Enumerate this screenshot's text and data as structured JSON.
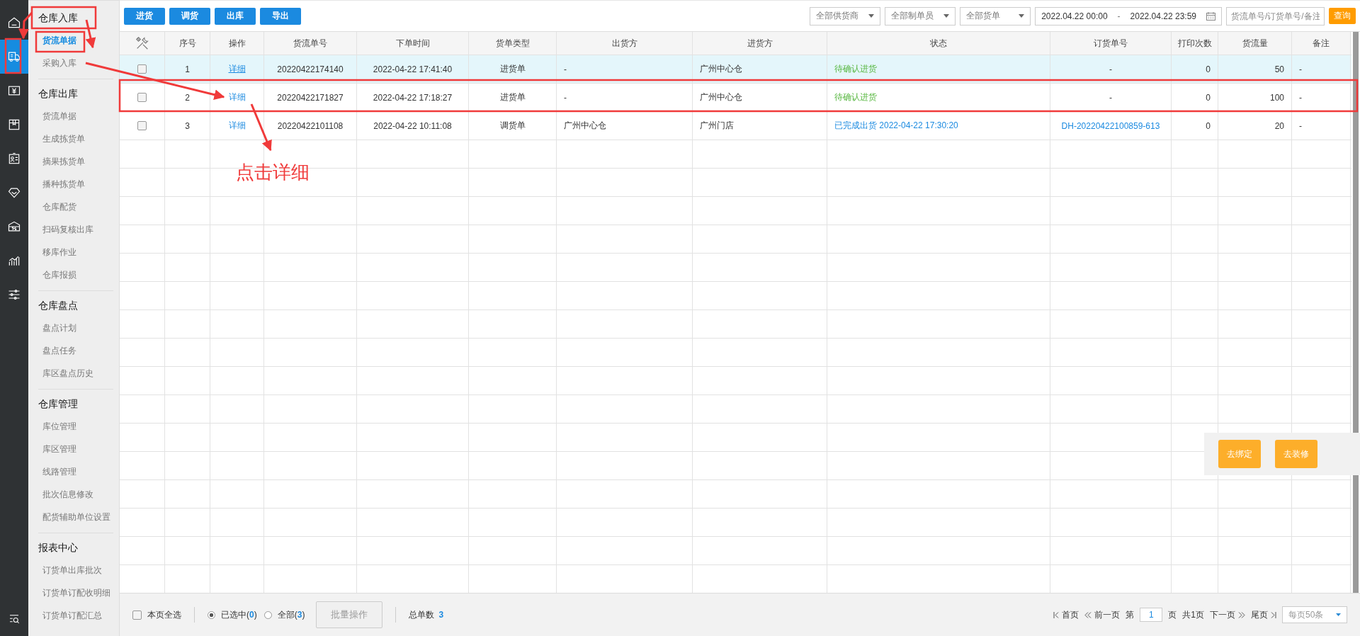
{
  "rail": {
    "items": [
      {
        "selected": false
      },
      {
        "selected": true
      },
      {
        "selected": false
      },
      {
        "selected": false
      },
      {
        "selected": false
      },
      {
        "selected": false
      },
      {
        "selected": false
      },
      {
        "selected": false
      },
      {
        "selected": false
      }
    ]
  },
  "sidebar": {
    "groups": [
      {
        "title": "仓库入库",
        "items": [
          {
            "label": "货流单据",
            "selected": true
          },
          {
            "label": "采购入库",
            "selected": false
          }
        ]
      },
      {
        "title": "仓库出库",
        "items": [
          {
            "label": "货流单据",
            "selected": false
          },
          {
            "label": "生成拣货单",
            "selected": false
          },
          {
            "label": "摘果拣货单",
            "selected": false
          },
          {
            "label": "播种拣货单",
            "selected": false
          },
          {
            "label": "仓库配货",
            "selected": false
          },
          {
            "label": "扫码复核出库",
            "selected": false
          },
          {
            "label": "移库作业",
            "selected": false
          },
          {
            "label": "仓库报损",
            "selected": false
          }
        ]
      },
      {
        "title": "仓库盘点",
        "items": [
          {
            "label": "盘点计划",
            "selected": false
          },
          {
            "label": "盘点任务",
            "selected": false
          },
          {
            "label": "库区盘点历史",
            "selected": false
          }
        ]
      },
      {
        "title": "仓库管理",
        "items": [
          {
            "label": "库位管理",
            "selected": false
          },
          {
            "label": "库区管理",
            "selected": false
          },
          {
            "label": "线路管理",
            "selected": false
          },
          {
            "label": "批次信息修改",
            "selected": false
          },
          {
            "label": "配货辅助单位设置",
            "selected": false
          }
        ]
      },
      {
        "title": "报表中心",
        "items": [
          {
            "label": "订货单出库批次",
            "selected": false
          },
          {
            "label": "订货单订配收明细",
            "selected": false
          },
          {
            "label": "订货单订配汇总",
            "selected": false
          }
        ]
      }
    ]
  },
  "toolbar": {
    "buttons": [
      "进货",
      "调货",
      "出库",
      "导出"
    ],
    "filters": [
      "全部供货商",
      "全部制单员",
      "全部货单"
    ],
    "date_range": {
      "start": "2022.04.22 00:00",
      "separator": "-",
      "end": "2022.04.22 23:59"
    },
    "search": {
      "placeholder": "货流单号/订货单号/备注"
    },
    "query_button": "查询"
  },
  "table": {
    "columns": [
      "序号",
      "操作",
      "货流单号",
      "下单时间",
      "货单类型",
      "出货方",
      "进货方",
      "状态",
      "订货单号",
      "打印次数",
      "货流量",
      "备注"
    ],
    "rows": [
      {
        "checked": false,
        "highlighted": true,
        "no": "1",
        "action": "详细",
        "action_underlined": true,
        "flow_no": "20220422174140",
        "time": "2022-04-22 17:41:40",
        "type": "进货单",
        "from": "-",
        "to": "广州中心仓",
        "status": {
          "text": "待确认进货",
          "kind": "pending"
        },
        "order_no": {
          "text": "-",
          "link": false
        },
        "prints": "0",
        "qty": "50",
        "note": "-"
      },
      {
        "checked": false,
        "highlighted": false,
        "no": "2",
        "action": "详细",
        "action_underlined": false,
        "flow_no": "20220422171827",
        "time": "2022-04-22 17:18:27",
        "type": "进货单",
        "from": "-",
        "to": "广州中心仓",
        "status": {
          "text": "待确认进货",
          "kind": "pending"
        },
        "order_no": {
          "text": "-",
          "link": false
        },
        "prints": "0",
        "qty": "100",
        "note": "-"
      },
      {
        "checked": false,
        "highlighted": false,
        "no": "3",
        "action": "详细",
        "action_underlined": false,
        "flow_no": "20220422101108",
        "time": "2022-04-22 10:11:08",
        "type": "调货单",
        "from": "广州中心仓",
        "to": "广州门店",
        "status": {
          "text": "已完成出货 2022-04-22 17:30:20",
          "kind": "done"
        },
        "order_no": {
          "text": "DH-20220422100859-613",
          "link": true
        },
        "prints": "0",
        "qty": "20",
        "note": "-"
      }
    ]
  },
  "float_panel": {
    "buttons": [
      "去绑定",
      "去装修"
    ]
  },
  "footer": {
    "select_all": {
      "label": "本页全选",
      "checked": false
    },
    "scope": [
      {
        "label": "已选中(**0**)",
        "selected": true
      },
      {
        "label": "全部(**3**)",
        "selected": false
      }
    ],
    "batch_button": {
      "label": "批量操作",
      "disabled": true
    },
    "total_label": "总单数",
    "total": "3",
    "pager": {
      "first": "首页",
      "prev": "前一页",
      "page_prefix": "第",
      "page": "1",
      "page_suffix": "页",
      "pages": "共1页",
      "next": "下一页",
      "last": "尾页",
      "per_page": "每页50条"
    }
  },
  "annotation": {
    "text": "点击详细"
  }
}
